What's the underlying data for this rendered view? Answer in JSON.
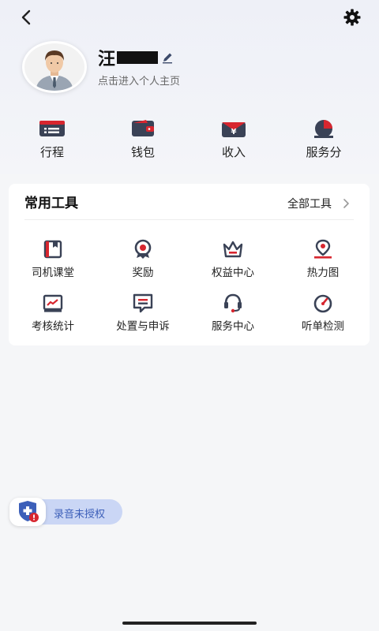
{
  "header": {
    "back_icon": "chevron-left-icon",
    "settings_icon": "gear-icon"
  },
  "profile": {
    "name_prefix": "汪",
    "subtitle": "点击进入个人主页",
    "edit_icon": "pencil-icon"
  },
  "quick_actions": [
    {
      "label": "行程",
      "icon": "itinerary-icon"
    },
    {
      "label": "钱包",
      "icon": "wallet-icon"
    },
    {
      "label": "收入",
      "icon": "income-icon"
    },
    {
      "label": "服务分",
      "icon": "service-score-icon"
    }
  ],
  "tools": {
    "title": "常用工具",
    "all_label": "全部工具",
    "items": [
      {
        "label": "司机课堂",
        "icon": "book-icon"
      },
      {
        "label": "奖励",
        "icon": "medal-icon"
      },
      {
        "label": "权益中心",
        "icon": "crown-icon"
      },
      {
        "label": "热力图",
        "icon": "map-pin-icon"
      },
      {
        "label": "考核统计",
        "icon": "chart-icon"
      },
      {
        "label": "处置与申诉",
        "icon": "message-icon"
      },
      {
        "label": "服务中心",
        "icon": "headset-icon"
      },
      {
        "label": "听单检测",
        "icon": "gauge-icon"
      }
    ]
  },
  "recording_badge": {
    "label": "录音未授权",
    "icon": "shield-alert-icon"
  },
  "colors": {
    "primary_dark": "#3a4256",
    "accent_red": "#d7262f",
    "badge_bg": "#cad6f5",
    "badge_text": "#3c5fb9"
  }
}
